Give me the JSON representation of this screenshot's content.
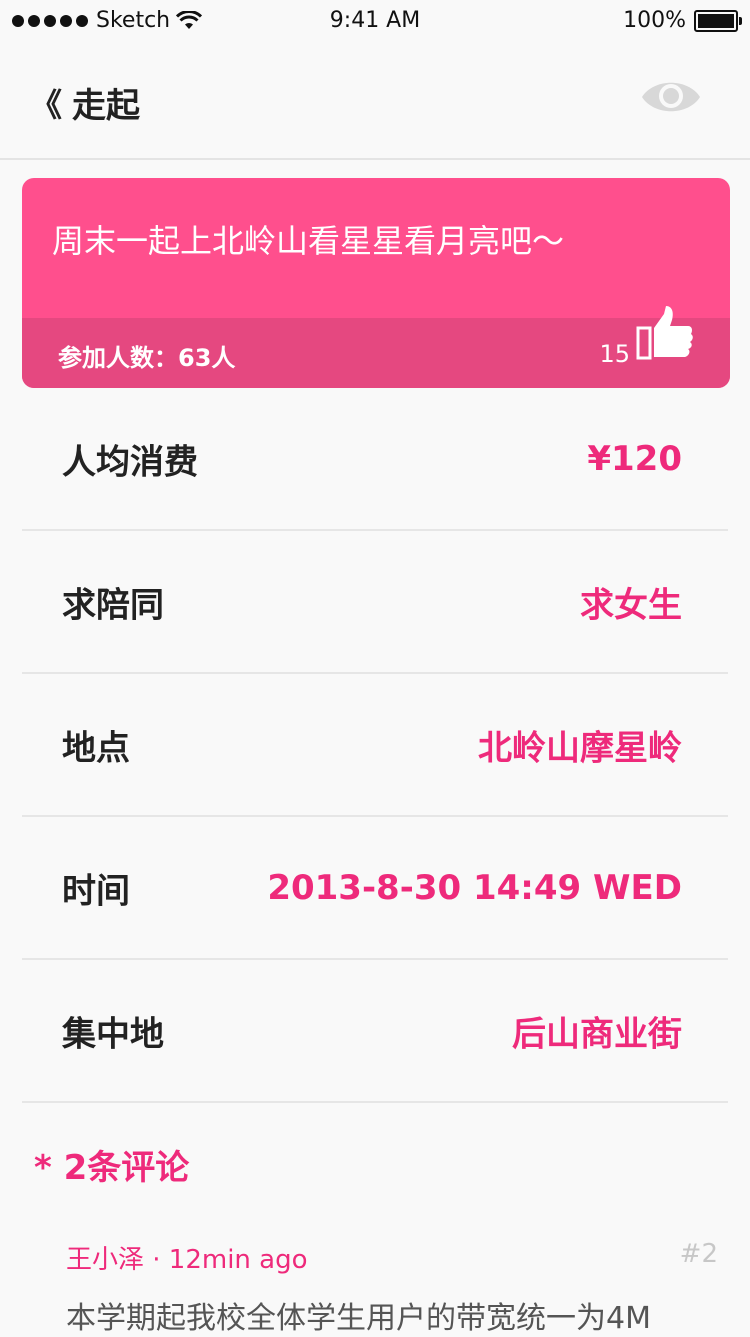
{
  "status_bar": {
    "carrier": "Sketch",
    "time": "9:41 AM",
    "battery": "100%"
  },
  "nav": {
    "back_label": "走起",
    "back_icon": "double-chevron-left-icon",
    "eye_icon": "eye-icon"
  },
  "event": {
    "title": "周末一起上北岭山看星星看月亮吧～",
    "participants": "参加人数：63人",
    "likes": "15",
    "like_icon": "thumbs-up-icon",
    "accent": "#ff4f8d"
  },
  "details": [
    {
      "label": "人均消费",
      "value": "¥120"
    },
    {
      "label": "求陪同",
      "value": "求女生"
    },
    {
      "label": "地点",
      "value": "北岭山摩星岭"
    },
    {
      "label": "时间",
      "value": "2013-8-30 14:49 WED"
    },
    {
      "label": "集中地",
      "value": "后山商业街"
    }
  ],
  "comments": {
    "header": "* 2条评论",
    "items": [
      {
        "meta": "王小泽 · 12min ago",
        "number": "#2",
        "text": "本学期起我校全体学生用户的带宽统一为4M"
      }
    ]
  }
}
